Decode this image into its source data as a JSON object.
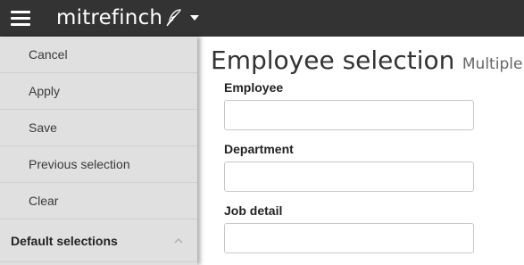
{
  "app": {
    "brand": "mitrefinch"
  },
  "sidebar": {
    "items": [
      {
        "label": "Cancel"
      },
      {
        "label": "Apply"
      },
      {
        "label": "Save"
      },
      {
        "label": "Previous selection"
      },
      {
        "label": "Clear"
      }
    ],
    "section": {
      "label": "Default selections",
      "state": "expanded"
    }
  },
  "main": {
    "title": "Employee selection",
    "subtitle": "Multiple",
    "fields": [
      {
        "label": "Employee",
        "value": "",
        "placeholder": ""
      },
      {
        "label": "Department",
        "value": "",
        "placeholder": ""
      },
      {
        "label": "Job detail",
        "value": "",
        "placeholder": ""
      }
    ]
  },
  "colors": {
    "topbar": "#333333",
    "sidebar": "#e0e0e0",
    "text": "#333333"
  },
  "icons": [
    "menu-icon",
    "feather-icon",
    "caret-down-icon",
    "chevron-up-icon"
  ]
}
